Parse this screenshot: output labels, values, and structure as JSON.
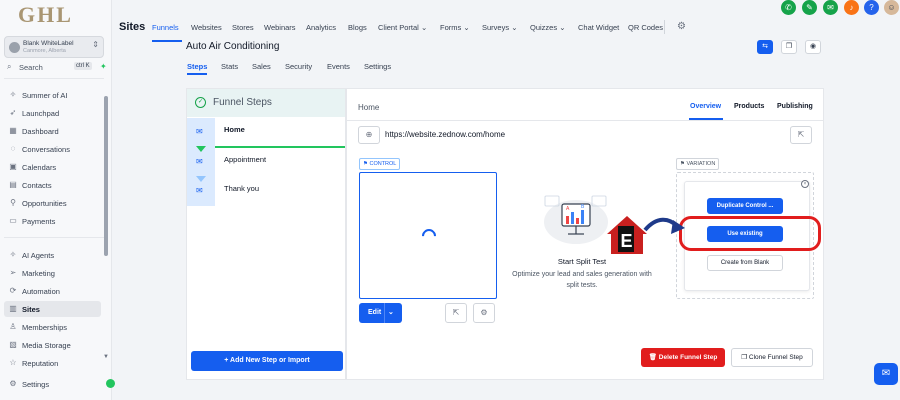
{
  "logo": "GHL",
  "account": {
    "name": "Blank WhiteLabel",
    "location": "Canmore, Alberta"
  },
  "search": {
    "placeholder": "Search",
    "shortcut": "ctrl K"
  },
  "sidebar": {
    "items": [
      {
        "label": "Summer of AI",
        "icon": "sparkle-icon"
      },
      {
        "label": "Launchpad",
        "icon": "rocket-icon"
      },
      {
        "label": "Dashboard",
        "icon": "grid-icon"
      },
      {
        "label": "Conversations",
        "icon": "chat-icon"
      },
      {
        "label": "Calendars",
        "icon": "calendar-icon"
      },
      {
        "label": "Contacts",
        "icon": "contacts-icon"
      },
      {
        "label": "Opportunities",
        "icon": "funnel-icon"
      },
      {
        "label": "Payments",
        "icon": "payments-icon"
      },
      {
        "label": "AI Agents",
        "icon": "ai-icon"
      },
      {
        "label": "Marketing",
        "icon": "send-icon"
      },
      {
        "label": "Automation",
        "icon": "automation-icon"
      },
      {
        "label": "Sites",
        "icon": "sites-icon"
      },
      {
        "label": "Memberships",
        "icon": "membership-icon"
      },
      {
        "label": "Media Storage",
        "icon": "media-icon"
      },
      {
        "label": "Reputation",
        "icon": "star-icon"
      },
      {
        "label": "Settings",
        "icon": "gear-icon"
      }
    ],
    "active": "Sites"
  },
  "topbar": {
    "section": "Sites",
    "nav": [
      "Funnels",
      "Websites",
      "Stores",
      "Webinars",
      "Analytics",
      "Blogs",
      "Client Portal",
      "Forms",
      "Surveys",
      "Quizzes",
      "Chat Widget",
      "QR Codes"
    ],
    "active": "Funnels"
  },
  "header_icons": [
    {
      "name": "phone-icon",
      "color": "#16a34a",
      "glyph": "✆"
    },
    {
      "name": "megaphone-icon",
      "color": "#16a34a",
      "glyph": "✎"
    },
    {
      "name": "chat-icon",
      "color": "#16a34a",
      "glyph": "✉"
    },
    {
      "name": "bell-icon",
      "color": "#f97316",
      "glyph": "♪"
    },
    {
      "name": "help-icon",
      "color": "#2563eb",
      "glyph": "?"
    }
  ],
  "funnel": {
    "title": "Auto Air Conditioning",
    "tabs": [
      "Steps",
      "Stats",
      "Sales",
      "Security",
      "Events",
      "Settings"
    ],
    "active_tab": "Steps"
  },
  "steps_panel": {
    "title": "Funnel Steps",
    "steps": [
      "Home",
      "Appointment",
      "Thank you"
    ],
    "add_label": "+ Add New Step or Import"
  },
  "main": {
    "page_name": "Home",
    "tabs": [
      "Overview",
      "Products",
      "Publishing"
    ],
    "active_tab": "Overview",
    "url": "https://website.zednow.com/home",
    "control_label": "CONTROL",
    "variation_label": "VARIATION",
    "edit_label": "Edit",
    "split_title": "Start Split Test",
    "split_sub": "Optimize your lead and sales generation with split tests.",
    "variation_buttons": {
      "duplicate": "Duplicate Control ...",
      "existing": "Use existing",
      "blank": "Create from Blank"
    },
    "delete_label": "Delete Funnel Step",
    "clone_label": "Clone Funnel Step"
  },
  "colors": {
    "primary": "#155eef",
    "danger": "#e11d1d",
    "success": "#22c55e",
    "logo": "#a99673"
  }
}
